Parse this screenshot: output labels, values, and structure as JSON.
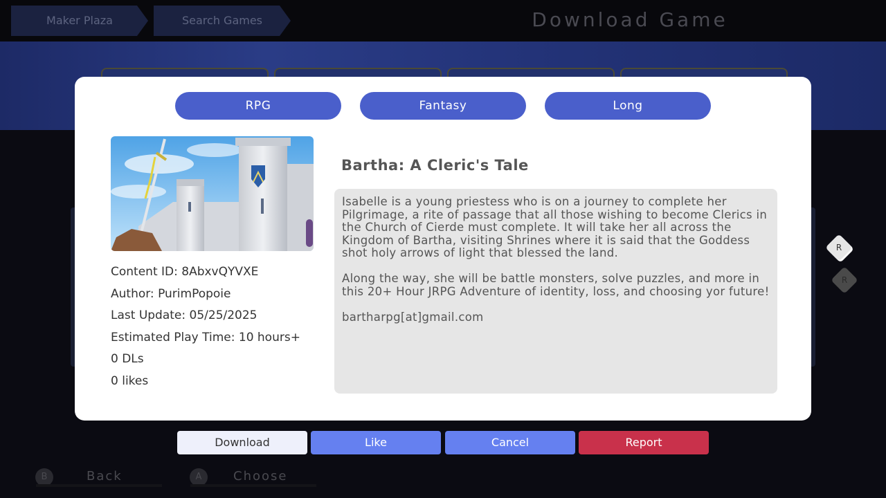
{
  "background": {
    "breadcrumbs": [
      "Maker Plaza",
      "Search Games"
    ],
    "screen_title": "Download Game",
    "footer": {
      "back": {
        "key": "B",
        "label": "Back"
      },
      "choose": {
        "key": "A",
        "label": "Choose"
      }
    },
    "page_indicators": [
      "R",
      "R"
    ]
  },
  "modal": {
    "tags": [
      "RPG",
      "Fantasy",
      "Long"
    ],
    "title": "Bartha: A Cleric's Tale",
    "meta": {
      "content_id": "Content ID: 8AbxvQYVXE",
      "author": "Author: PurimPopoie",
      "last_update": "Last Update: 05/25/2025",
      "play_time": "Estimated Play Time: 10 hours+",
      "downloads": "0 DLs",
      "likes": "0  likes"
    },
    "description": [
      "Isabelle is a young priestess who is on a journey to complete her Pilgrimage, a rite of passage that all those wishing to become Clerics in the Church of Cierde must complete. It will take her all across the Kingdom of Bartha, visiting Shrines where it is said that the Goddess shot holy arrows of light that blessed the land.",
      "Along the way, she will be battle monsters, solve puzzles, and more in this 20+ Hour JRPG Adventure of identity, loss, and choosing yor future!",
      "bartharpg[at]gmail.com"
    ]
  },
  "actions": {
    "download": "Download",
    "like": "Like",
    "cancel": "Cancel",
    "report": "Report"
  },
  "colors": {
    "tag": "#4a5fcb",
    "like_cancel": "#6580f0",
    "report": "#c9314b",
    "download": "#eef0fb"
  }
}
